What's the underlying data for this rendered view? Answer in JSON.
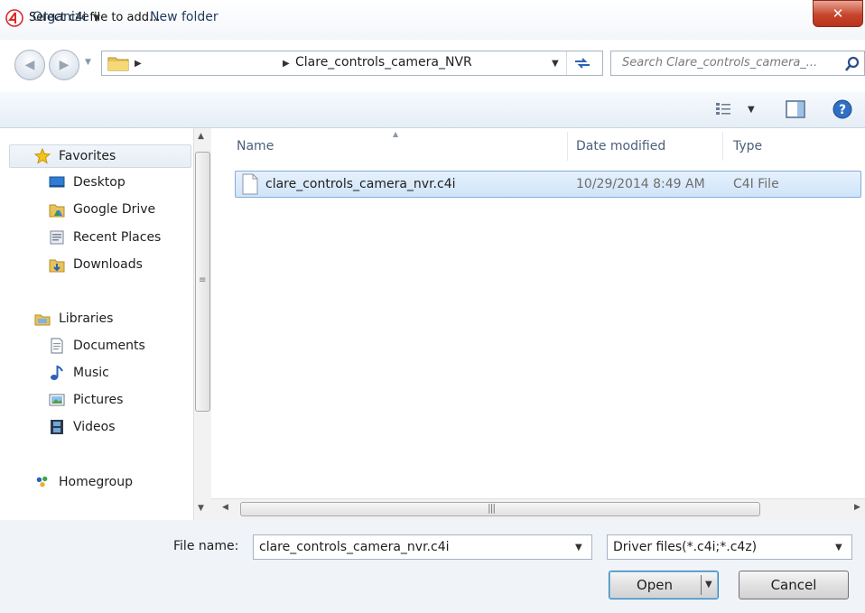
{
  "window": {
    "title": "Select c4i file to add..."
  },
  "navigation": {
    "breadcrumb_folder": "Clare_controls_camera_NVR",
    "search_placeholder": "Search Clare_controls_camera_..."
  },
  "toolbar": {
    "organize_label": "Organize",
    "new_folder_label": "New folder"
  },
  "sidebar": {
    "favorites_label": "Favorites",
    "favorites": [
      "Desktop",
      "Google Drive",
      "Recent Places",
      "Downloads"
    ],
    "libraries_label": "Libraries",
    "libraries": [
      "Documents",
      "Music",
      "Pictures",
      "Videos"
    ],
    "homegroup_label": "Homegroup"
  },
  "file_list": {
    "columns": [
      "Name",
      "Date modified",
      "Type"
    ],
    "rows": [
      {
        "name": "clare_controls_camera_nvr.c4i",
        "date_modified": "10/29/2014 8:49 AM",
        "type": "C4I File"
      }
    ]
  },
  "footer": {
    "file_name_label": "File name:",
    "file_name_value": "clare_controls_camera_nvr.c4i",
    "file_type_value": "Driver files(*.c4i;*.c4z)",
    "open_label": "Open",
    "cancel_label": "Cancel"
  },
  "colors": {
    "accent": "#1e395b",
    "selection": "#cfe4fa",
    "close": "#c8452c"
  }
}
